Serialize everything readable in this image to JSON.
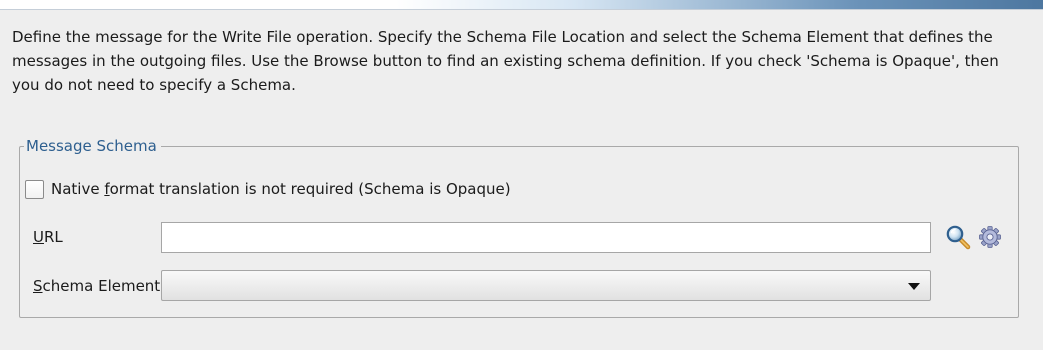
{
  "instructions": "Define the message for the Write File operation.  Specify the Schema File Location and select the Schema Element that defines the messages in the outgoing files. Use the Browse button to find an existing schema definition. If you check 'Schema is Opaque', then you do not need to specify a Schema.",
  "message_schema": {
    "title": "Message Schema",
    "opaque_checkbox": {
      "label_before": "Native ",
      "label_mnemonic": "f",
      "label_after": "ormat translation is not required (Schema is Opaque)",
      "checked": false
    },
    "url": {
      "label_mnemonic": "U",
      "label_after": "RL",
      "value": "",
      "placeholder": ""
    },
    "schema_element": {
      "label_mnemonic": "S",
      "label_after": "chema Element",
      "selected": ""
    },
    "icons": {
      "browse": "search-icon",
      "generate": "gear-icon"
    }
  },
  "colors": {
    "background": "#eeeeee",
    "group_title": "#2e5f8f",
    "border": "#a9a9a9"
  }
}
